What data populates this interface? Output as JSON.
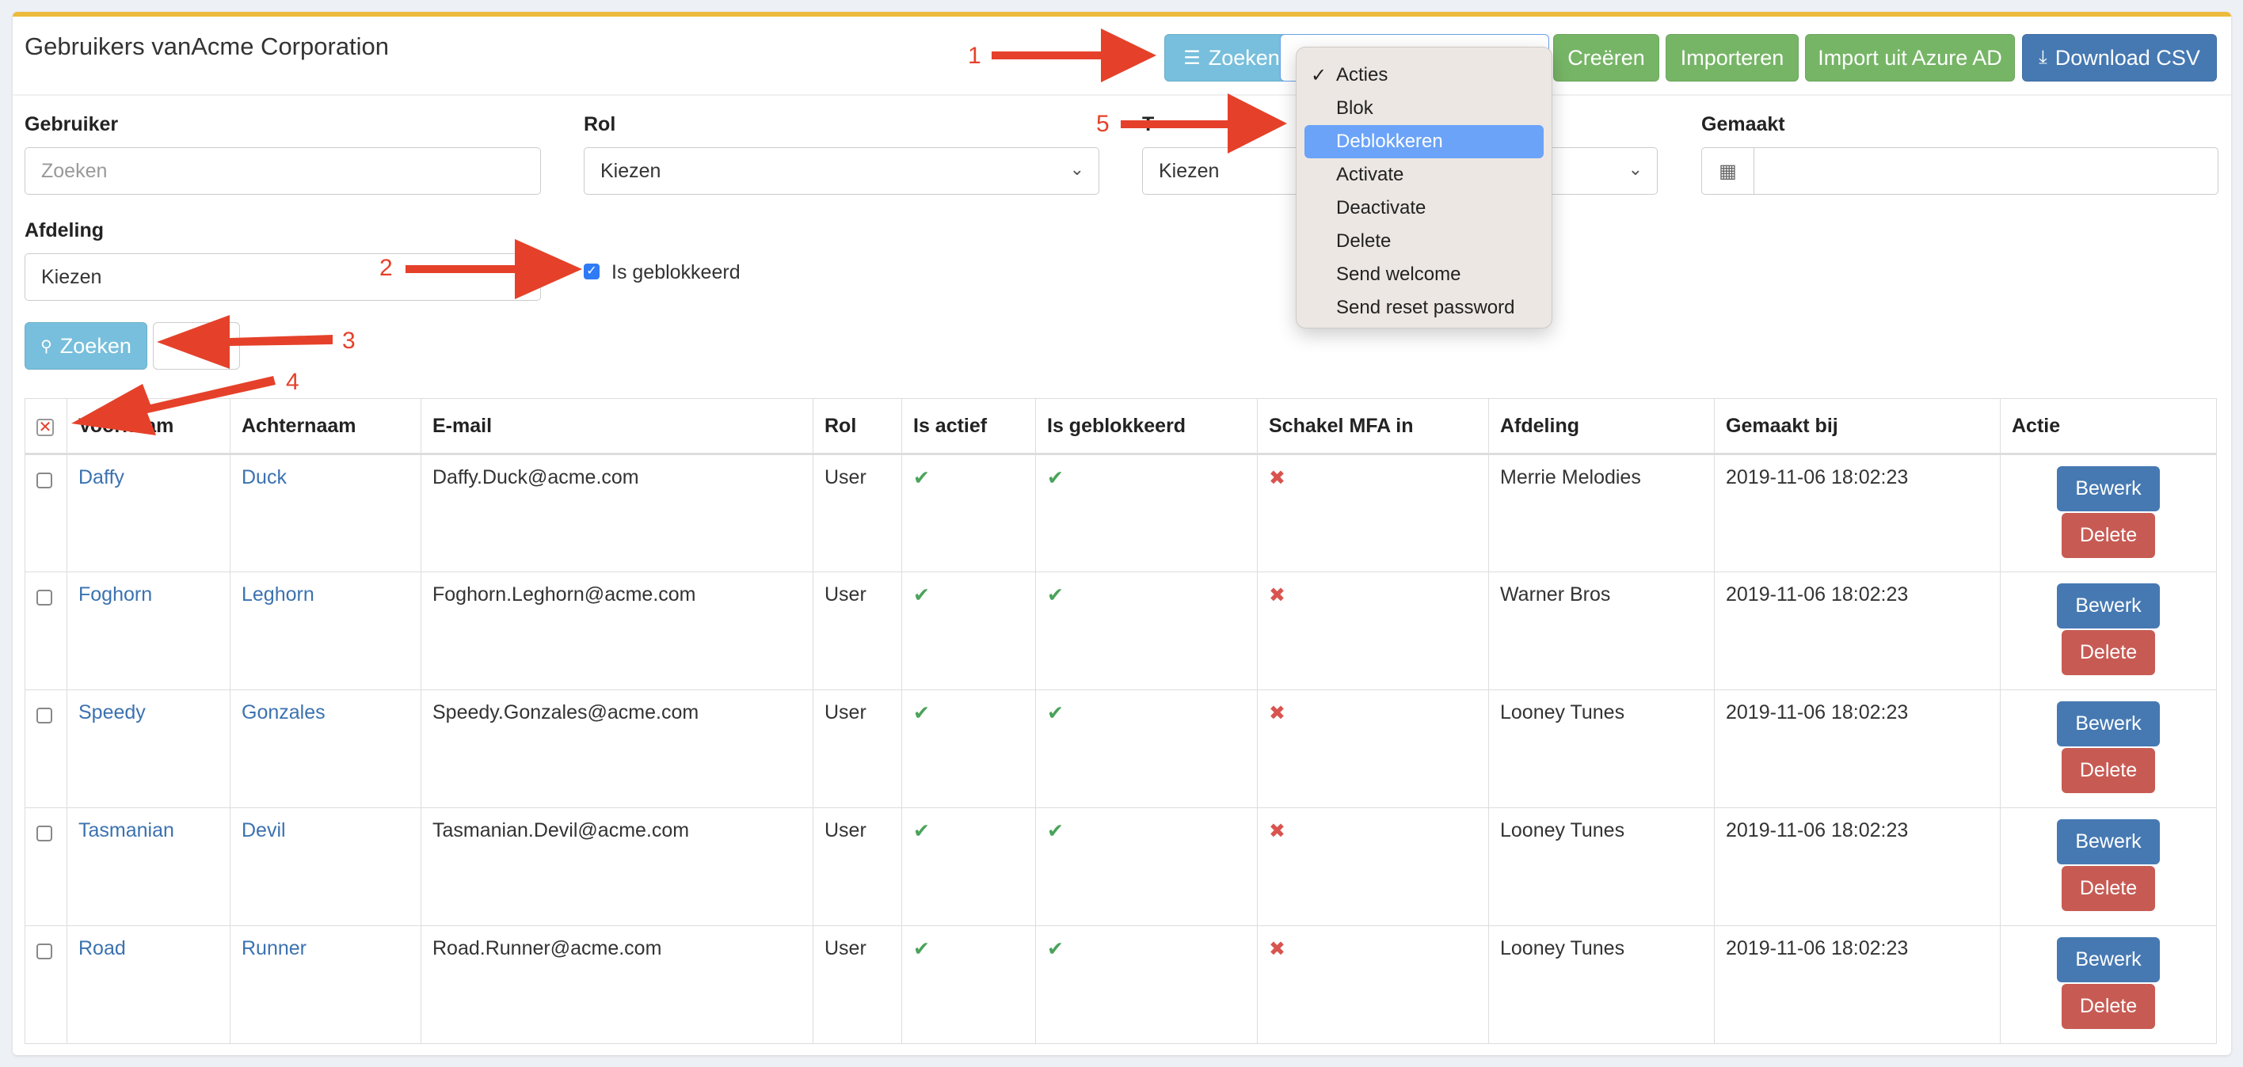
{
  "page": {
    "title": "Gebruikers vanAcme Corporation"
  },
  "toolbar": {
    "search_toggle_label": "Zoeken",
    "actions_select_value": "Acties",
    "create_label": "Creëren",
    "import_label": "Importeren",
    "import_azure_label": "Import uit Azure AD",
    "download_csv_label": "Download CSV"
  },
  "actions_dropdown": {
    "items": [
      {
        "label": "Acties",
        "checked": true,
        "highlighted": false
      },
      {
        "label": "Blok",
        "checked": false,
        "highlighted": false
      },
      {
        "label": "Deblokkeren",
        "checked": false,
        "highlighted": true
      },
      {
        "label": "Activate",
        "checked": false,
        "highlighted": false
      },
      {
        "label": "Deactivate",
        "checked": false,
        "highlighted": false
      },
      {
        "label": "Delete",
        "checked": false,
        "highlighted": false
      },
      {
        "label": "Send welcome",
        "checked": false,
        "highlighted": false
      },
      {
        "label": "Send reset password",
        "checked": false,
        "highlighted": false
      }
    ]
  },
  "filters": {
    "user_label": "Gebruiker",
    "user_placeholder": "Zoeken",
    "role_label": "Rol",
    "role_value": "Kiezen",
    "third_label_visible": "T",
    "third_value": "Kiezen",
    "created_label": "Gemaakt",
    "created_value": "",
    "department_label": "Afdeling",
    "department_value": "Kiezen",
    "is_blocked_label": "Is geblokkeerd",
    "is_blocked_checked": true,
    "search_button_label": "Zoeken"
  },
  "table": {
    "columns": [
      "",
      "Voornaam",
      "Achternaam",
      "E-mail",
      "Rol",
      "Is actief",
      "Is geblokkeerd",
      "Schakel MFA in",
      "Afdeling",
      "Gemaakt bij",
      "Actie"
    ],
    "rows": [
      {
        "first": "Daffy",
        "last": "Duck",
        "email": "Daffy.Duck@acme.com",
        "role": "User",
        "active": "✔",
        "blocked": "✔",
        "mfa": "✖",
        "department": "Merrie Melodies",
        "created": "2019-11-06 18:02:23",
        "edit": "Bewerk",
        "delete": "Delete"
      },
      {
        "first": "Foghorn",
        "last": "Leghorn",
        "email": "Foghorn.Leghorn@acme.com",
        "role": "User",
        "active": "✔",
        "blocked": "✔",
        "mfa": "✖",
        "department": "Warner Bros",
        "created": "2019-11-06 18:02:23",
        "edit": "Bewerk",
        "delete": "Delete"
      },
      {
        "first": "Speedy",
        "last": "Gonzales",
        "email": "Speedy.Gonzales@acme.com",
        "role": "User",
        "active": "✔",
        "blocked": "✔",
        "mfa": "✖",
        "department": "Looney Tunes",
        "created": "2019-11-06 18:02:23",
        "edit": "Bewerk",
        "delete": "Delete"
      },
      {
        "first": "Tasmanian",
        "last": "Devil",
        "email": "Tasmanian.Devil@acme.com",
        "role": "User",
        "active": "✔",
        "blocked": "✔",
        "mfa": "✖",
        "department": "Looney Tunes",
        "created": "2019-11-06 18:02:23",
        "edit": "Bewerk",
        "delete": "Delete"
      },
      {
        "first": "Road",
        "last": "Runner",
        "email": "Road.Runner@acme.com",
        "role": "User",
        "active": "✔",
        "blocked": "✔",
        "mfa": "✖",
        "department": "Looney Tunes",
        "created": "2019-11-06 18:02:23",
        "edit": "Bewerk",
        "delete": "Delete"
      }
    ]
  },
  "annotations": {
    "n1": "1",
    "n2": "2",
    "n3": "3",
    "n4": "4",
    "n5": "5",
    "color": "#e5412a"
  },
  "icons": {
    "sliders": "☰",
    "search": "🔍",
    "download": "⤓",
    "calendar": "📅",
    "check": "✓",
    "chevron": "⌄",
    "check_mark": "✔"
  },
  "colors": {
    "accent_top": "#ecbb3c",
    "info": "#77bfdc",
    "success": "#76b566",
    "primary": "#4679b2",
    "danger": "#c75b54",
    "link": "#3b72b0"
  }
}
